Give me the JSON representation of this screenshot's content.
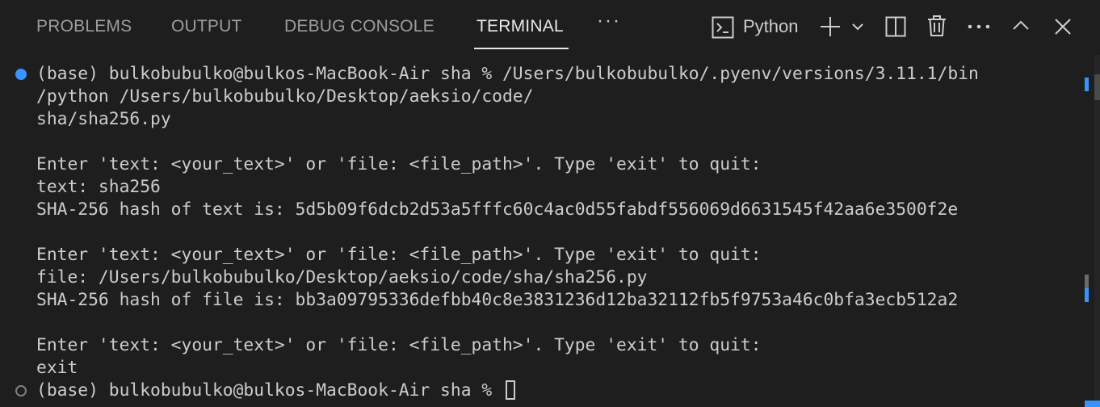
{
  "panel": {
    "tabs": [
      {
        "label": "PROBLEMS",
        "active": false
      },
      {
        "label": "OUTPUT",
        "active": false
      },
      {
        "label": "DEBUG CONSOLE",
        "active": false
      },
      {
        "label": "TERMINAL",
        "active": true
      }
    ],
    "more_tabs": "···",
    "terminal_name": "Python",
    "accent_color": "#3794ff"
  },
  "terminal": {
    "lines": [
      "(base) bulkobubulko@bulkos-MacBook-Air sha % /Users/bulkobubulko/.pyenv/versions/3.11.1/bin",
      "/python /Users/bulkobubulko/Desktop/aeksio/code/",
      "sha/sha256.py",
      "",
      "Enter 'text: <your_text>' or 'file: <file_path>'. Type 'exit' to quit:",
      "text: sha256",
      "SHA-256 hash of text is: 5d5b09f6dcb2d53a5fffc60c4ac0d55fabdf556069d6631545f42aa6e3500f2e",
      "",
      "Enter 'text: <your_text>' or 'file: <file_path>'. Type 'exit' to quit:",
      "file: /Users/bulkobubulko/Desktop/aeksio/code/sha/sha256.py",
      "SHA-256 hash of file is: bb3a09795336defbb40c8e3831236d12ba32112fb5f9753a46c0bfa3ecb512a2",
      "",
      "Enter 'text: <your_text>' or 'file: <file_path>'. Type 'exit' to quit:",
      "exit"
    ],
    "prompt": "(base) bulkobubulko@bulkos-MacBook-Air sha % "
  }
}
